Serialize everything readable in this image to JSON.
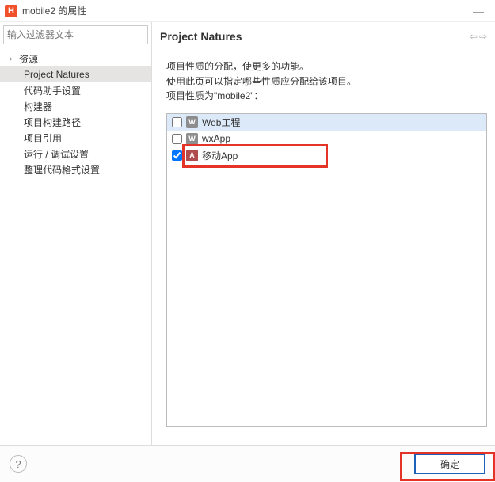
{
  "window": {
    "title": "mobile2 的属性",
    "app_icon_letter": "H"
  },
  "left": {
    "filter_placeholder": "输入过滤器文本",
    "tree": {
      "root": "资源",
      "items": [
        "Project Natures",
        "代码助手设置",
        "构建器",
        "项目构建路径",
        "项目引用",
        "运行 / 调试设置",
        "整理代码格式设置"
      ],
      "selected_index": 0
    }
  },
  "right": {
    "heading": "Project Natures",
    "desc": {
      "line1": "项目性质的分配，使更多的功能。",
      "line2": "使用此页可以指定哪些性质应分配给该项目。",
      "line3": "项目性质为\"mobile2\"："
    },
    "natures": [
      {
        "checked": false,
        "badge": "W",
        "badgeClass": "w",
        "label": "Web工程"
      },
      {
        "checked": false,
        "badge": "W",
        "badgeClass": "w",
        "label": "wxApp"
      },
      {
        "checked": true,
        "badge": "A",
        "badgeClass": "a",
        "label": "移动App"
      }
    ],
    "selected_row": 0
  },
  "footer": {
    "ok_label": "确定"
  }
}
